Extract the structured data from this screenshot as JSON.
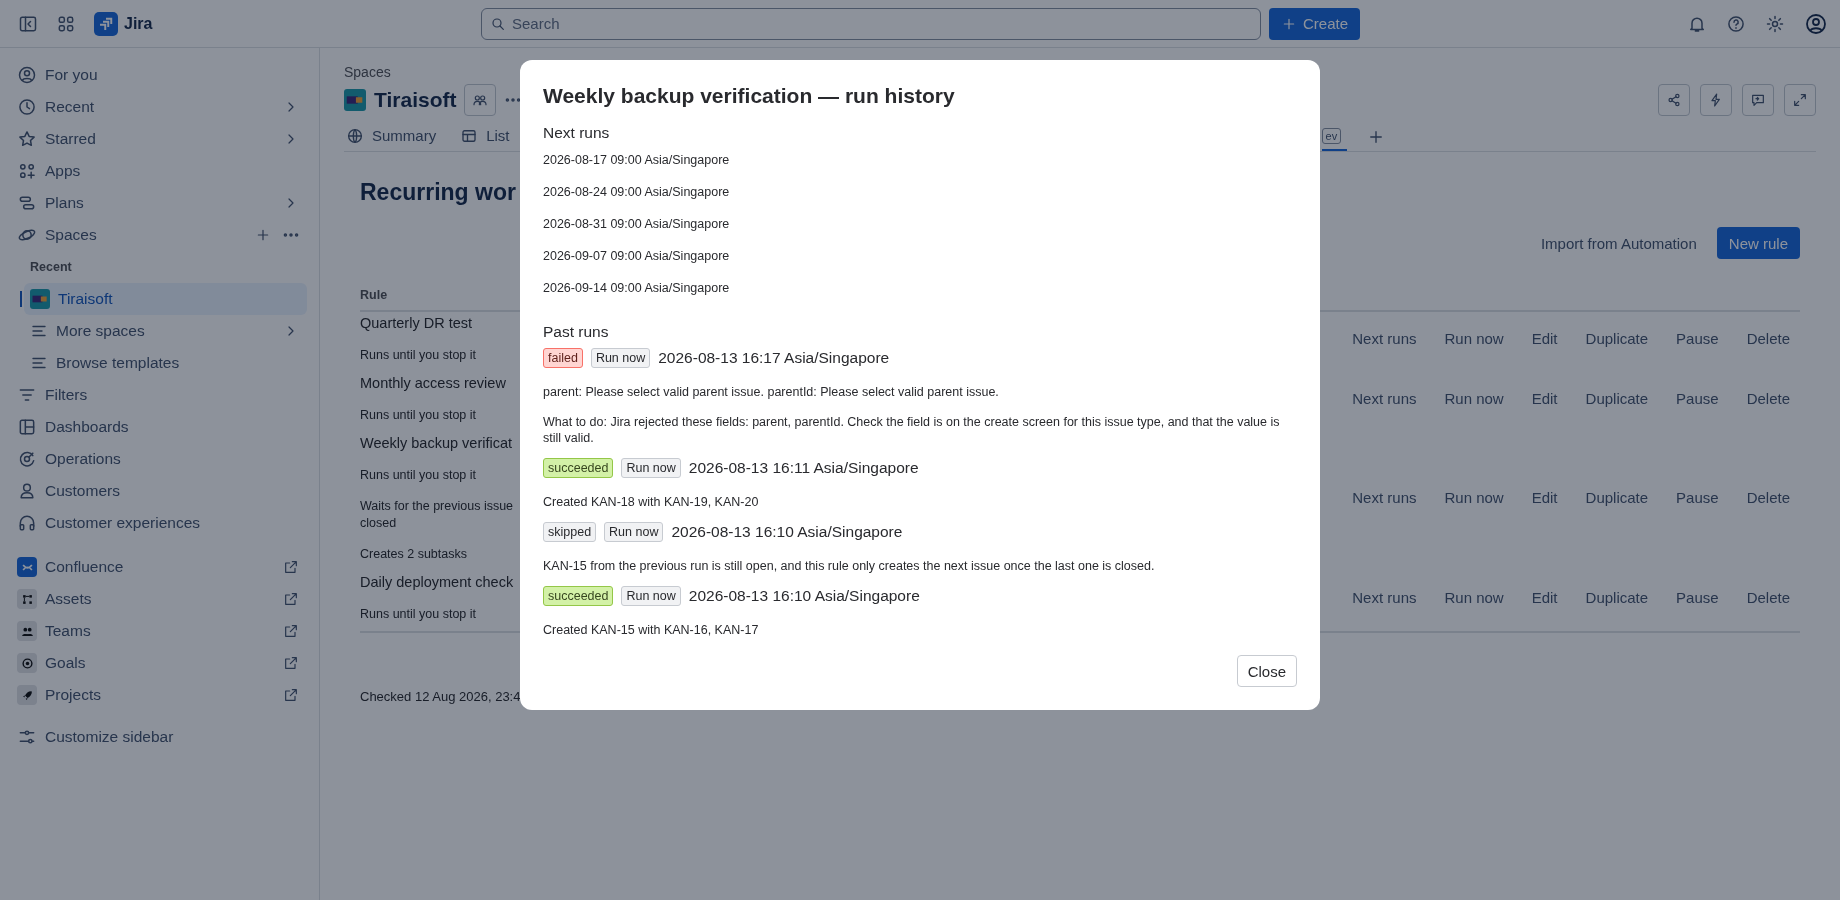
{
  "top_bar": {
    "product": "Jira",
    "search": {
      "placeholder": "Search"
    },
    "create_button": "Create"
  },
  "sidebar": {
    "items": [
      {
        "kind": "nav",
        "label": "For you",
        "selected": false,
        "submenu": false
      },
      {
        "kind": "nav",
        "label": "Recent",
        "selected": false,
        "submenu": true
      },
      {
        "kind": "nav",
        "label": "Starred",
        "selected": false,
        "submenu": true
      },
      {
        "kind": "nav",
        "label": "Apps",
        "selected": false,
        "submenu": false
      },
      {
        "kind": "nav",
        "label": "Plans",
        "selected": false,
        "submenu": true
      },
      {
        "kind": "spaces",
        "label": "Spaces",
        "selected": false,
        "submenu": false
      },
      {
        "kind": "heading",
        "label": "Recent"
      },
      {
        "kind": "space",
        "label": "Tiraisoft",
        "selected": true,
        "submenu": false
      },
      {
        "kind": "sub",
        "label": "More spaces",
        "selected": false,
        "submenu": true
      },
      {
        "kind": "sub",
        "label": "Browse templates",
        "selected": false,
        "submenu": false
      },
      {
        "kind": "nav",
        "label": "Filters",
        "selected": false,
        "submenu": false
      },
      {
        "kind": "nav",
        "label": "Dashboards",
        "selected": false,
        "submenu": false
      },
      {
        "kind": "nav",
        "label": "Operations",
        "selected": false,
        "submenu": false
      },
      {
        "kind": "nav",
        "label": "Customers",
        "selected": false,
        "submenu": false
      },
      {
        "kind": "nav",
        "label": "Customer experiences",
        "selected": false,
        "submenu": false
      },
      {
        "kind": "app",
        "label": "Confluence",
        "selected": false,
        "submenu": false
      },
      {
        "kind": "app",
        "label": "Assets",
        "selected": false,
        "submenu": false
      },
      {
        "kind": "app",
        "label": "Teams",
        "selected": false,
        "submenu": false
      },
      {
        "kind": "app",
        "label": "Goals",
        "selected": false,
        "submenu": false
      },
      {
        "kind": "app",
        "label": "Projects",
        "selected": false,
        "submenu": false
      },
      {
        "kind": "footer",
        "label": "Customize sidebar",
        "selected": false,
        "submenu": false
      }
    ]
  },
  "space_header": {
    "breadcrumb": "Spaces",
    "name": "Tiraisoft",
    "tabs": [
      {
        "label": "Summary",
        "selected": false
      },
      {
        "label": "List",
        "selected": false
      },
      {
        "lozenge": "ev",
        "selected": true
      }
    ]
  },
  "page": {
    "heading": "Recurring wor",
    "import_button": "Import from Automation",
    "new_button": "New rule",
    "table": {
      "columns": [
        "Rule"
      ],
      "rows": [
        {
          "name": "Quarterly DR test",
          "notes": [
            "Runs until you stop it"
          ],
          "actions": [
            "Next runs",
            "Run now",
            "Edit",
            "Duplicate",
            "Pause",
            "Delete"
          ]
        },
        {
          "name": "Monthly access review",
          "notes": [
            "Runs until you stop it"
          ],
          "actions": [
            "Next runs",
            "Run now",
            "Edit",
            "Duplicate",
            "Pause",
            "Delete"
          ]
        },
        {
          "name": "Weekly backup verificat",
          "notes": [
            "Runs until you stop it",
            "Waits for the previous issue closed",
            "Creates 2 subtasks"
          ],
          "actions": [
            "Next runs",
            "Run now",
            "Edit",
            "Duplicate",
            "Pause",
            "Delete"
          ]
        },
        {
          "name": "Daily deployment check",
          "notes": [
            "Runs until you stop it"
          ],
          "actions": [
            "Next runs",
            "Run now",
            "Edit",
            "Duplicate",
            "Pause",
            "Delete"
          ]
        }
      ]
    },
    "footer": "Checked 12 Aug 2026, 23:4"
  },
  "dialog": {
    "title": "Weekly backup verification — run history",
    "next_runs": {
      "heading": "Next runs",
      "items": [
        "2026-08-17 09:00 Asia/Singapore",
        "2026-08-24 09:00 Asia/Singapore",
        "2026-08-31 09:00 Asia/Singapore",
        "2026-09-07 09:00 Asia/Singapore",
        "2026-09-14 09:00 Asia/Singapore"
      ]
    },
    "past_runs": {
      "heading": "Past runs",
      "runs": [
        {
          "kind": "failed",
          "badge": "failed",
          "button": "Run now",
          "time": "2026-08-13 16:17 Asia/Singapore",
          "messages": [
            "parent: Please select valid parent issue. parentId: Please select valid parent issue.",
            "What to do: Jira rejected these fields: parent, parentId. Check the field is on the create screen for this issue type, and that the value is still valid."
          ]
        },
        {
          "kind": "succeeded",
          "badge": "succeeded",
          "button": "Run now",
          "time": "2026-08-13 16:11 Asia/Singapore",
          "messages": [
            "Created KAN-18 with KAN-19, KAN-20"
          ]
        },
        {
          "kind": "skipped",
          "badge": "skipped",
          "button": "Run now",
          "time": "2026-08-13 16:10 Asia/Singapore",
          "messages": [
            "KAN-15 from the previous run is still open, and this rule only creates the next issue once the last one is closed."
          ]
        },
        {
          "kind": "succeeded",
          "badge": "succeeded",
          "button": "Run now",
          "time": "2026-08-13 16:10 Asia/Singapore",
          "messages": [
            "Created KAN-15 with KAN-16, KAN-17"
          ]
        }
      ]
    },
    "close_button": "Close"
  }
}
